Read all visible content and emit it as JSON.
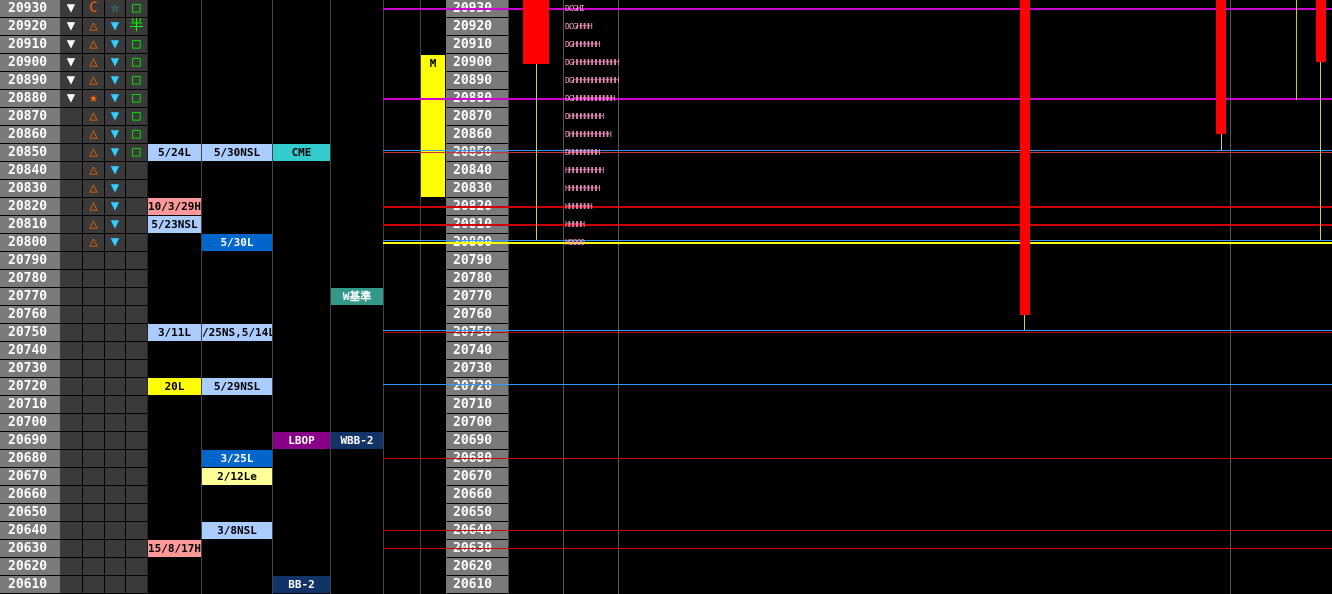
{
  "colors": {
    "price_bg": "#7a7a7a",
    "marker_bg": "#3a3a3a",
    "magenta": "#cc00cc",
    "red": "#cc0000",
    "blue": "#3399ff",
    "yellow": "#ffff00",
    "candle": "#ff0000"
  },
  "rows": [
    {
      "price": "20930",
      "m1": "▼",
      "m2": "C",
      "m3": "☆",
      "m4": "□",
      "price2": "20930"
    },
    {
      "price": "20920",
      "m1": "▼",
      "m2": "△",
      "m3": "▼",
      "m4": "半",
      "price2": "20920"
    },
    {
      "price": "20910",
      "m1": "▼",
      "m2": "△",
      "m3": "▼",
      "m4": "□",
      "price2": "20910"
    },
    {
      "price": "20900",
      "m1": "▼",
      "m2": "△",
      "m3": "▼",
      "m4": "□",
      "price2": "20900",
      "mcol": "M"
    },
    {
      "price": "20890",
      "m1": "▼",
      "m2": "△",
      "m3": "▼",
      "m4": "□",
      "price2": "20890"
    },
    {
      "price": "20880",
      "m1": "▼",
      "m2": "★",
      "m3": "▼",
      "m4": "□",
      "price2": "20880"
    },
    {
      "price": "20870",
      "m1": "",
      "m2": "△",
      "m3": "▼",
      "m4": "□",
      "price2": "20870"
    },
    {
      "price": "20860",
      "m1": "",
      "m2": "△",
      "m3": "▼",
      "m4": "□",
      "price2": "20860"
    },
    {
      "price": "20850",
      "m1": "",
      "m2": "△",
      "m3": "▼",
      "m4": "□",
      "price2": "20850",
      "l1": "5/24L",
      "l2": "5/30NSL",
      "l3": "CME"
    },
    {
      "price": "20840",
      "m1": "",
      "m2": "△",
      "m3": "▼",
      "m4": "",
      "price2": "20840"
    },
    {
      "price": "20830",
      "m1": "",
      "m2": "△",
      "m3": "▼",
      "m4": "",
      "price2": "20830"
    },
    {
      "price": "20820",
      "m1": "",
      "m2": "△",
      "m3": "▼",
      "m4": "",
      "price2": "20820",
      "l1": "10/3/29H"
    },
    {
      "price": "20810",
      "m1": "",
      "m2": "△",
      "m3": "▼",
      "m4": "",
      "price2": "20810",
      "l1": "5/23NSL"
    },
    {
      "price": "20800",
      "m1": "",
      "m2": "△",
      "m3": "▼",
      "m4": "",
      "price2": "20800",
      "l2": "5/30L"
    },
    {
      "price": "20790",
      "price2": "20790"
    },
    {
      "price": "20780",
      "price2": "20780"
    },
    {
      "price": "20770",
      "price2": "20770",
      "l4": "W基準"
    },
    {
      "price": "20760",
      "price2": "20760"
    },
    {
      "price": "20750",
      "price2": "20750",
      "l1": "3/11L",
      "l2": "/25NS,5/14L"
    },
    {
      "price": "20740",
      "price2": "20740"
    },
    {
      "price": "20730",
      "price2": "20730"
    },
    {
      "price": "20720",
      "price2": "20720",
      "l1": "20L",
      "l2": "5/29NSL"
    },
    {
      "price": "20710",
      "price2": "20710"
    },
    {
      "price": "20700",
      "price2": "20700"
    },
    {
      "price": "20690",
      "price2": "20690",
      "l3": "LBOP",
      "l4": "WBB-2"
    },
    {
      "price": "20680",
      "price2": "20680",
      "l2": "3/25L"
    },
    {
      "price": "20670",
      "price2": "20670",
      "l2": "2/12Le"
    },
    {
      "price": "20660",
      "price2": "20660"
    },
    {
      "price": "20650",
      "price2": "20650"
    },
    {
      "price": "20640",
      "price2": "20640",
      "l2": "3/8NSL"
    },
    {
      "price": "20630",
      "price2": "20630",
      "l1": "15/8/17H"
    },
    {
      "price": "20620",
      "price2": "20620"
    },
    {
      "price": "20610",
      "price2": "20610",
      "l3": "BB-2"
    }
  ],
  "profile": [
    {
      "price": "20930",
      "text": "DCGHI"
    },
    {
      "price": "20920",
      "text": "DCGHHHH"
    },
    {
      "price": "20910",
      "text": "DGHHHHHHH"
    },
    {
      "price": "20900",
      "text": "DGHHHHHHHHHHHH"
    },
    {
      "price": "20890",
      "text": "DGHHHHHHHHHHHH"
    },
    {
      "price": "20880",
      "text": "DGHHHHHHHHHHH"
    },
    {
      "price": "20870",
      "text": "DHHHHHHHHH"
    },
    {
      "price": "20860",
      "text": "DHHHHHHHHHHH"
    },
    {
      "price": "20850",
      "text": "DHHHHHHHH"
    },
    {
      "price": "20840",
      "text": "HHHHHHHHHH"
    },
    {
      "price": "20830",
      "text": "HHHHHHHHH"
    },
    {
      "price": "20820",
      "text": "HHHHHHH"
    },
    {
      "price": "20810",
      "text": "HHHHH"
    },
    {
      "price": "20800",
      "text": "H0000"
    }
  ]
}
